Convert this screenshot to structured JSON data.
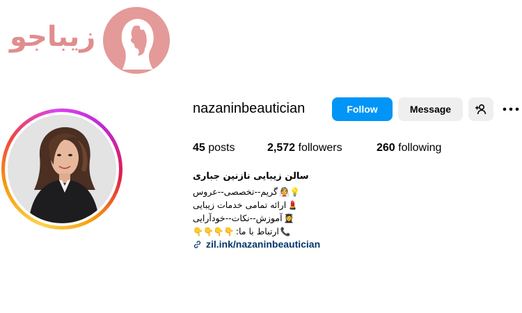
{
  "brand": {
    "logo_text": "زیباجو",
    "color": "#e08d8d"
  },
  "profile": {
    "username": "nazaninbeautician",
    "follow_label": "Follow",
    "message_label": "Message",
    "add_user_icon": "add-user-icon",
    "more_icon": "more-dots-icon"
  },
  "stats": {
    "posts_count": "45",
    "posts_label": "posts",
    "followers_count": "2,572",
    "followers_label": "followers",
    "following_count": "260",
    "following_label": "following"
  },
  "bio": {
    "name": "سالن زیبایی نازنین جباری",
    "lines": [
      {
        "text": "گریم--تخصصی--عروس",
        "emoji": "👰💡"
      },
      {
        "text": "ارائه تمامی خدمات زیبایی",
        "emoji": "💄"
      },
      {
        "text": "آموزش--نکات--خودآرایی",
        "emoji": "👩‍🎓"
      },
      {
        "text": "ارتباط با ما:",
        "emoji": "📞",
        "pointers": "👇👇👇👇"
      }
    ],
    "link": "zil.ink/nazaninbeautician",
    "link_icon": "link-icon"
  },
  "colors": {
    "follow_button": "#0095f6",
    "secondary_button": "#efefef",
    "link": "#00376b"
  }
}
